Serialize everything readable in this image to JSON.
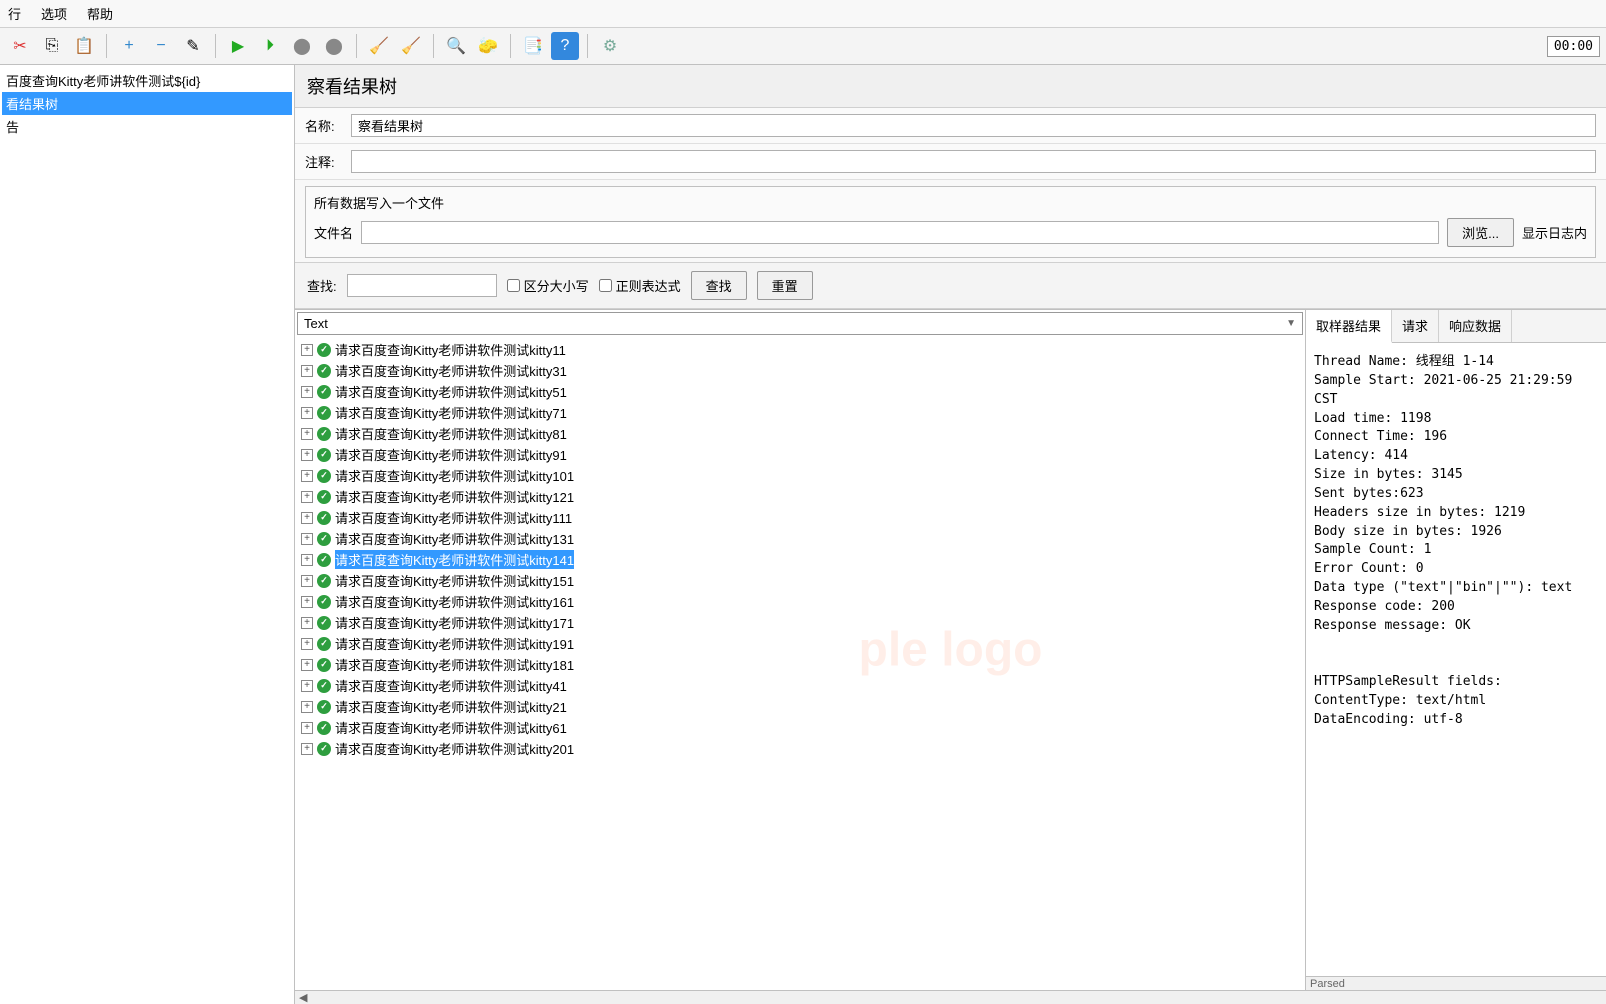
{
  "menu": {
    "run": "行",
    "options": "选项",
    "help": "帮助"
  },
  "timer": "00:00",
  "leftTree": {
    "item0": "百度查询Kitty老师讲软件测试${id}",
    "item1": "看结果树",
    "item2": "告"
  },
  "panel": {
    "title": "察看结果树",
    "nameLabel": "名称:",
    "nameValue": "察看结果树",
    "commentLabel": "注释:",
    "commentValue": ""
  },
  "fileSection": {
    "legend": "所有数据写入一个文件",
    "fileLabel": "文件名",
    "fileValue": "",
    "browse": "浏览...",
    "logLabel": "显示日志内"
  },
  "search": {
    "label": "查找:",
    "value": "",
    "caseSensitive": "区分大小写",
    "regex": "正则表达式",
    "searchBtn": "查找",
    "resetBtn": "重置"
  },
  "combo": {
    "text": "Text"
  },
  "results": [
    {
      "label": "请求百度查询Kitty老师讲软件测试kitty11",
      "selected": false
    },
    {
      "label": "请求百度查询Kitty老师讲软件测试kitty31",
      "selected": false
    },
    {
      "label": "请求百度查询Kitty老师讲软件测试kitty51",
      "selected": false
    },
    {
      "label": "请求百度查询Kitty老师讲软件测试kitty71",
      "selected": false
    },
    {
      "label": "请求百度查询Kitty老师讲软件测试kitty81",
      "selected": false
    },
    {
      "label": "请求百度查询Kitty老师讲软件测试kitty91",
      "selected": false
    },
    {
      "label": "请求百度查询Kitty老师讲软件测试kitty101",
      "selected": false
    },
    {
      "label": "请求百度查询Kitty老师讲软件测试kitty121",
      "selected": false
    },
    {
      "label": "请求百度查询Kitty老师讲软件测试kitty111",
      "selected": false
    },
    {
      "label": "请求百度查询Kitty老师讲软件测试kitty131",
      "selected": false
    },
    {
      "label": "请求百度查询Kitty老师讲软件测试kitty141",
      "selected": true
    },
    {
      "label": "请求百度查询Kitty老师讲软件测试kitty151",
      "selected": false
    },
    {
      "label": "请求百度查询Kitty老师讲软件测试kitty161",
      "selected": false
    },
    {
      "label": "请求百度查询Kitty老师讲软件测试kitty171",
      "selected": false
    },
    {
      "label": "请求百度查询Kitty老师讲软件测试kitty191",
      "selected": false
    },
    {
      "label": "请求百度查询Kitty老师讲软件测试kitty181",
      "selected": false
    },
    {
      "label": "请求百度查询Kitty老师讲软件测试kitty41",
      "selected": false
    },
    {
      "label": "请求百度查询Kitty老师讲软件测试kitty21",
      "selected": false
    },
    {
      "label": "请求百度查询Kitty老师讲软件测试kitty61",
      "selected": false
    },
    {
      "label": "请求百度查询Kitty老师讲软件测试kitty201",
      "selected": false
    }
  ],
  "tabs": {
    "sampler": "取样器结果",
    "request": "请求",
    "response": "响应数据"
  },
  "detail": {
    "line1": "Thread Name: 线程组 1-14",
    "line2": "Sample Start: 2021-06-25 21:29:59 CST",
    "line3": "Load time: 1198",
    "line4": "Connect Time: 196",
    "line5": "Latency: 414",
    "line6": "Size in bytes: 3145",
    "line7": "Sent bytes:623",
    "line8": "Headers size in bytes: 1219",
    "line9": "Body size in bytes: 1926",
    "line10": "Sample Count: 1",
    "line11": "Error Count: 0",
    "line12": "Data type (\"text\"|\"bin\"|\"\"): text",
    "line13": "Response code: 200",
    "line14": "Response message: OK",
    "blank": "",
    "line15": "HTTPSampleResult fields:",
    "line16": "ContentType: text/html",
    "line17": "DataEncoding: utf-8"
  },
  "parsed": "Parsed",
  "watermark": "ple logo"
}
